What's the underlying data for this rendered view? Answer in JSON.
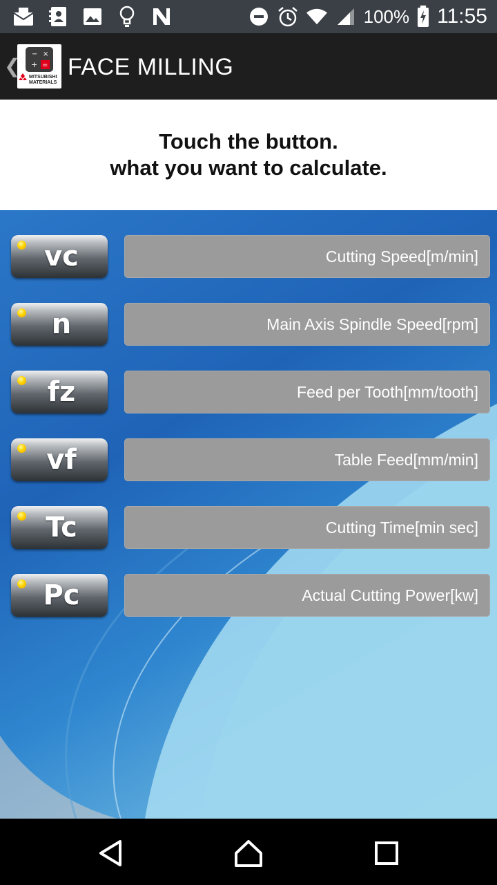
{
  "status_bar": {
    "battery": "100%",
    "time": "11:55",
    "icons": [
      "mail-icon",
      "contacts-icon",
      "image-icon",
      "bulb-icon",
      "n-icon",
      "dnd-icon",
      "alarm-icon",
      "wifi-icon",
      "signal-icon",
      "battery-icon"
    ]
  },
  "app_bar": {
    "back_icon": "chevron-left-icon",
    "logo_icon": "calculator-logo-icon",
    "logo_text_line1": "MITSUBISHI",
    "logo_text_line2": "MATERIALS",
    "title": "FACE MILLING"
  },
  "instruction": {
    "line1": "Touch the button.",
    "line2": "what you want to calculate."
  },
  "rows": [
    {
      "symbol": "vc",
      "description": "Cutting Speed[m/min]"
    },
    {
      "symbol": "n",
      "description": "Main Axis Spindle Speed[rpm]"
    },
    {
      "symbol": "fz",
      "description": "Feed per Tooth[mm/tooth]"
    },
    {
      "symbol": "vf",
      "description": "Table Feed[mm/min]"
    },
    {
      "symbol": "Tc",
      "description": "Cutting Time[min sec]"
    },
    {
      "symbol": "Pc",
      "description": "Actual Cutting Power[kw]"
    }
  ],
  "nav_bar": {
    "icons": [
      "back-triangle-icon",
      "home-icon",
      "recents-icon"
    ]
  },
  "colors": {
    "status_bar": "#3a4046",
    "app_bar": "#1e1e1e",
    "desc_button": "#9b9b9b",
    "indicator_dot": "#ffd400"
  }
}
